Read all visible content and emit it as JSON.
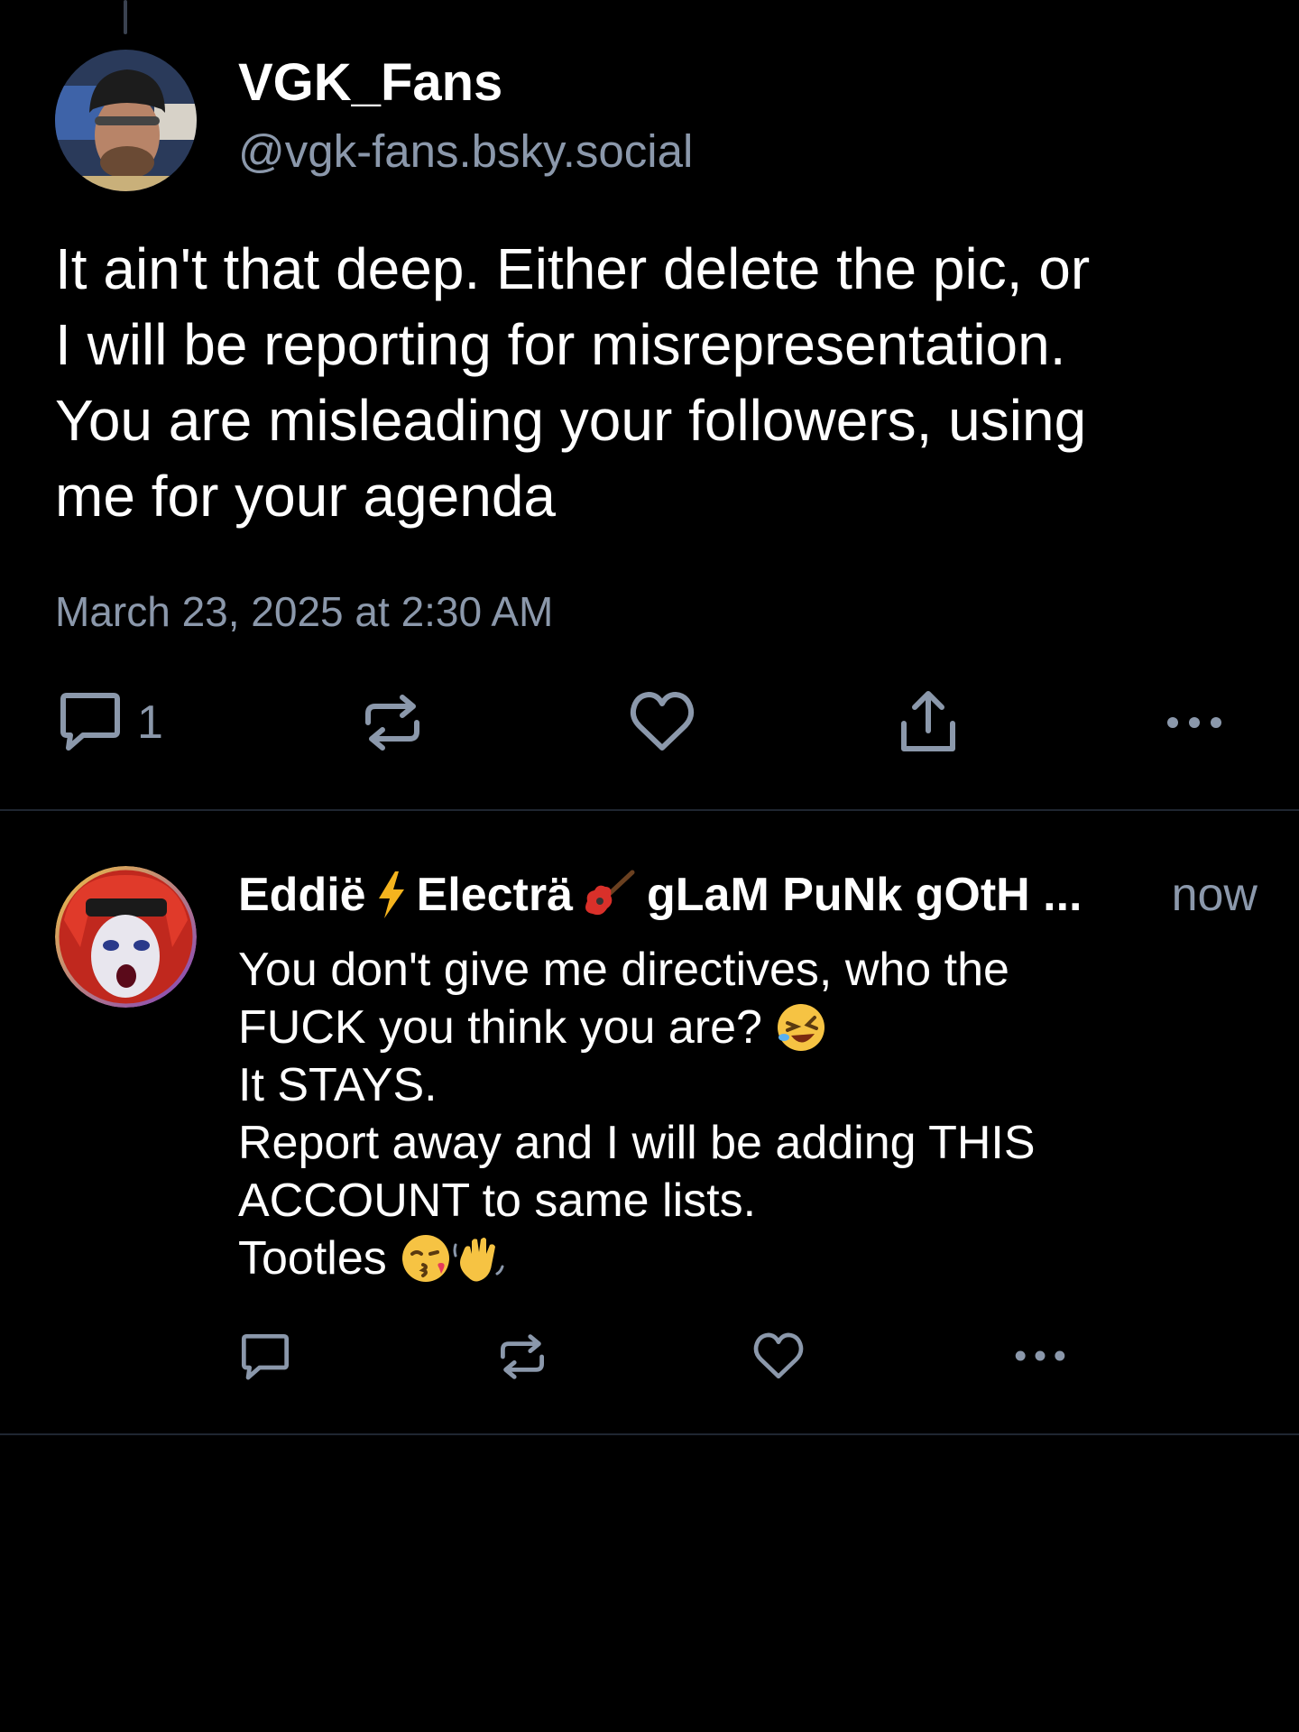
{
  "focus_post": {
    "display_name": "VGK_Fans",
    "handle": "@vgk-fans.bsky.social",
    "text_lines": [
      "It ain't that deep. Either delete the pic, or",
      "I will be reporting for misrepresentation.",
      "You are misleading your followers, using",
      "me for your agenda"
    ],
    "timestamp": "March 23, 2025 at 2:30 AM",
    "actions": {
      "reply_icon": "comment-icon",
      "reply_count": "1",
      "repost_icon": "repost-icon",
      "like_icon": "heart-icon",
      "share_icon": "share-icon",
      "more_icon": "more-icon"
    }
  },
  "reply_post": {
    "display_name_parts": [
      "Eddië",
      "Electrä",
      "gLaM PuNk gOtH ..."
    ],
    "name_emojis": [
      "lightning-emoji",
      "guitar-emoji"
    ],
    "time": "now",
    "text_lines": [
      "You don't give me directives, who the",
      "FUCK you think you are?",
      "It STAYS.",
      "Report away and I will be adding THIS",
      "ACCOUNT to same lists.",
      "Tootles"
    ],
    "text_emojis": [
      "rolling-laughing-emoji",
      "kiss-emoji",
      "waving-hand-emoji"
    ],
    "actions": {
      "reply_icon": "comment-icon",
      "repost_icon": "repost-icon",
      "like_icon": "heart-icon",
      "more_icon": "more-icon"
    }
  },
  "colors": {
    "background": "#000000",
    "primary_text": "#ffffff",
    "secondary_text": "#8b98ab",
    "divider": "#1f2631"
  }
}
